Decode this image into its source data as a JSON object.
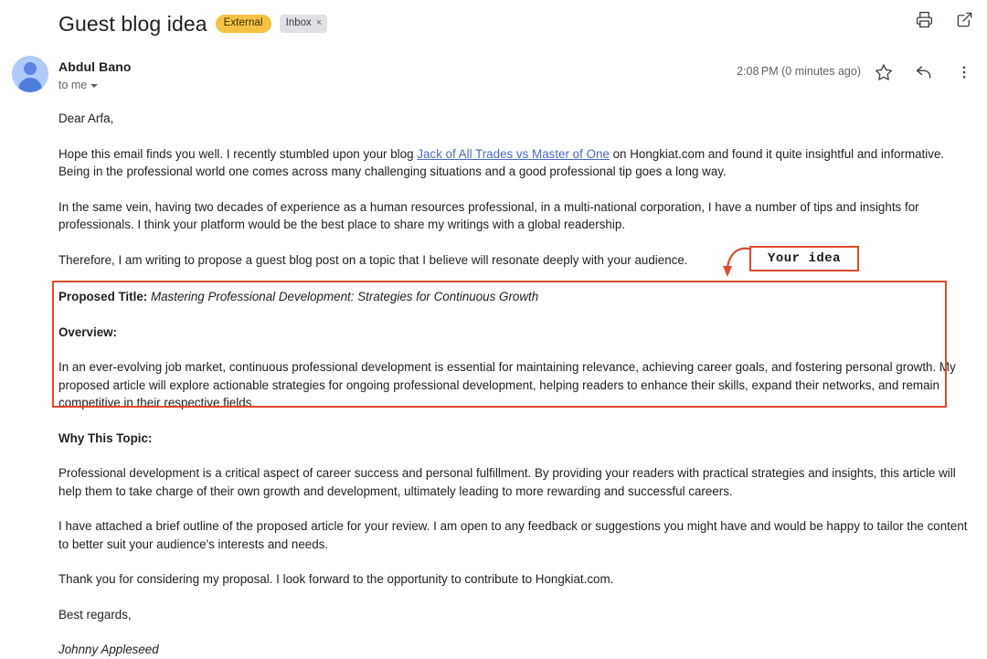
{
  "header": {
    "subject": "Guest blog idea",
    "badges": {
      "external": "External",
      "inbox": "Inbox",
      "inbox_close": "×"
    },
    "actions": {
      "print": "print-icon",
      "open_in_new": "open-in-new-icon"
    }
  },
  "sender": {
    "name": "Abdul Bano",
    "recipient": "to me",
    "timestamp": "2:08 PM (0 minutes ago)",
    "actions": {
      "star": "star-icon",
      "reply": "reply-icon",
      "more": "more-vertical-icon"
    }
  },
  "body": {
    "salutation": "Dear Arfa,",
    "p1_before_link": "Hope this email finds you well. I recently stumbled upon your blog ",
    "p1_link": "Jack of All Trades vs Master of One",
    "p1_after_link": " on Hongkiat.com and found it quite insightful and informative. Being in the professional world one comes across many challenging situations and a good professional tip goes a long way.",
    "p2": "In the same vein, having two decades of experience as a human resources professional, in a multi-national corporation, I have a number of tips and insights for professionals. I think your platform would be the best place to share my writings with a global readership.",
    "p3": "Therefore, I am writing to propose a guest blog post on a topic that I believe will resonate deeply with your audience.",
    "proposed_title_label": "Proposed Title:",
    "proposed_title_value": " Mastering Professional Development: Strategies for Continuous Growth",
    "overview_label": "Overview:",
    "overview_text": "In an ever-evolving job market, continuous professional development is essential for maintaining relevance, achieving career goals, and fostering personal growth. My proposed article will explore actionable strategies for ongoing professional development, helping readers to enhance their skills, expand their networks, and remain competitive in their respective fields.",
    "why_label": "Why This Topic:",
    "why_text": "Professional development is a critical aspect of career success and personal fulfillment. By providing your readers with practical strategies and insights, this article will help them to take charge of their own growth and development, ultimately leading to more rewarding and successful careers.",
    "p4": "I have attached a brief outline of the proposed article for your review. I am open to any feedback or suggestions you might have and would be happy to tailor the content to better suit your audience's interests and needs.",
    "p5": "Thank you for considering my proposal. I look forward to the opportunity to contribute to Hongkiat.com.",
    "closing": "Best regards,",
    "signature": "Johnny Appleseed"
  },
  "annotation": {
    "label": "Your idea"
  },
  "colors": {
    "accent_red": "#e0492c",
    "badge_external_bg": "#f6c244",
    "badge_inbox_bg": "#dfe1e5",
    "link": "#4a69c4",
    "avatar_bg": "#aecbfa"
  }
}
